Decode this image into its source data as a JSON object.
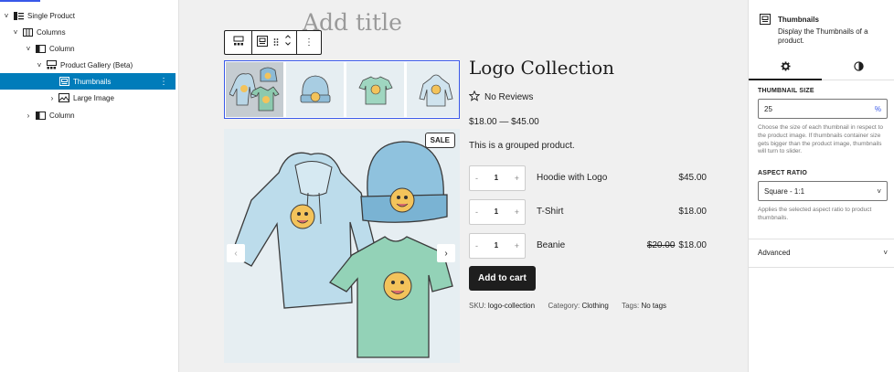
{
  "list_view": {
    "items": [
      {
        "label": "Single Product",
        "chevron": "˅",
        "icon": "single-product-icon"
      },
      {
        "label": "Columns",
        "chevron": "˅",
        "icon": "columns-icon"
      },
      {
        "label": "Column",
        "chevron": "˅",
        "icon": "column-icon"
      },
      {
        "label": "Product Gallery (Beta)",
        "chevron": "˅",
        "icon": "gallery-icon"
      },
      {
        "label": "Thumbnails",
        "chevron": "",
        "icon": "thumbnails-icon",
        "selected": true
      },
      {
        "label": "Large Image",
        "chevron": "›",
        "icon": "image-icon"
      },
      {
        "label": "Column",
        "chevron": "›",
        "icon": "column-icon"
      }
    ],
    "options_glyph": "⋮"
  },
  "canvas": {
    "title_placeholder": "Add title",
    "toolbar": {
      "more_glyph": "⋮"
    },
    "sale_badge": "SALE",
    "gallery_nav": {
      "prev": "‹",
      "next": "›"
    },
    "product": {
      "title": "Logo Collection",
      "reviews": "No Reviews",
      "price": "$18.00 — $45.00",
      "description": "This is a grouped product.",
      "grouped": [
        {
          "name": "Hoodie with Logo",
          "qty": "1",
          "price": "$45.00",
          "old_price": ""
        },
        {
          "name": "T-Shirt",
          "qty": "1",
          "price": "$18.00",
          "old_price": ""
        },
        {
          "name": "Beanie",
          "qty": "1",
          "price": "$18.00",
          "old_price": "$20.00"
        }
      ],
      "qty_minus": "-",
      "qty_plus": "+",
      "add_to_cart": "Add to cart",
      "meta": {
        "sku_label": "SKU:",
        "sku": "logo-collection",
        "category_label": "Category:",
        "category": "Clothing",
        "tags_label": "Tags:",
        "tags": "No tags"
      }
    }
  },
  "inspector": {
    "block_title": "Thumbnails",
    "block_desc": "Display the Thumbnails of a product.",
    "tabs": [
      "settings",
      "styles"
    ],
    "thumbnail_size": {
      "label": "THUMBNAIL SIZE",
      "value": "25",
      "unit": "%",
      "help": "Choose the size of each thumbnail in respect to the product image. If thumbnails container size gets bigger than the product image, thumbnails will turn to slider."
    },
    "aspect_ratio": {
      "label": "ASPECT RATIO",
      "value": "Square - 1:1",
      "help": "Applies the selected aspect ratio to product thumbnails."
    },
    "advanced": "Advanced",
    "chevron": "˅"
  },
  "colors": {
    "accent": "#3858e9",
    "selected_row": "#007cba",
    "button": "#1e1e1e"
  }
}
